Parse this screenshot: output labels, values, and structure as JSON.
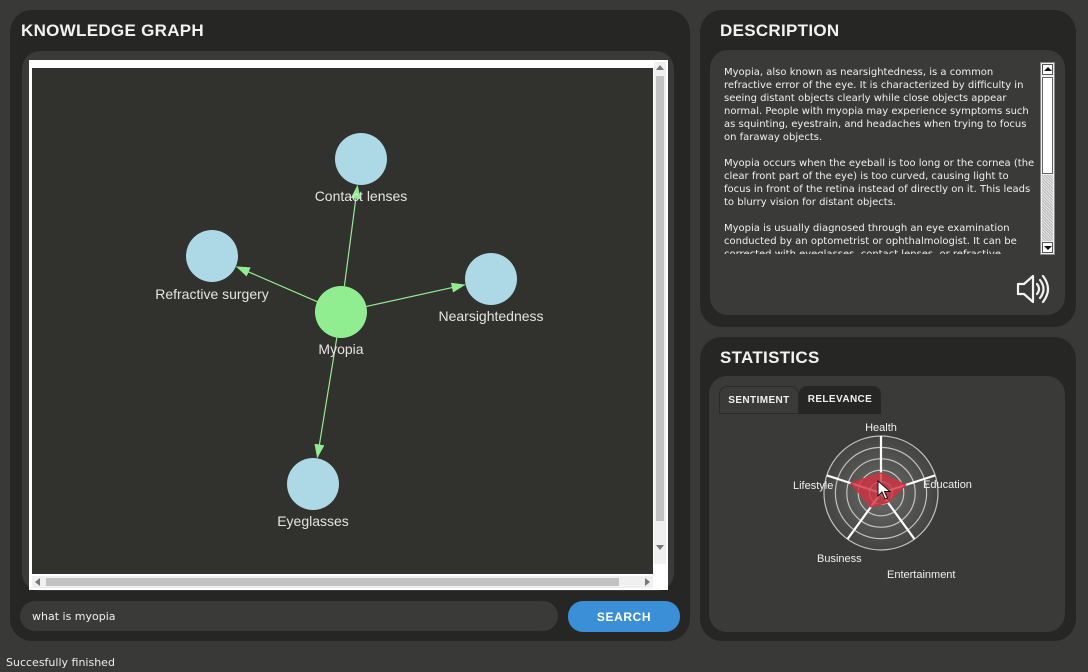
{
  "knowledge_graph": {
    "title": "KNOWLEDGE GRAPH",
    "nodes": [
      {
        "id": "myopia",
        "label": "Myopia",
        "color": "#90ee90"
      },
      {
        "id": "contact",
        "label": "Contact lenses",
        "color": "#add8e6"
      },
      {
        "id": "refractive",
        "label": "Refractive surgery",
        "color": "#add8e6"
      },
      {
        "id": "nearsight",
        "label": "Nearsightedness",
        "color": "#add8e6"
      },
      {
        "id": "eyeglasses",
        "label": "Eyeglasses",
        "color": "#add8e6"
      }
    ],
    "edges": [
      {
        "from": "myopia",
        "to": "contact"
      },
      {
        "from": "myopia",
        "to": "refractive"
      },
      {
        "from": "myopia",
        "to": "nearsight"
      },
      {
        "from": "myopia",
        "to": "eyeglasses"
      }
    ],
    "edge_color": "#90ee90",
    "query_value": "what is myopia",
    "search_label": "SEARCH"
  },
  "description": {
    "title": "DESCRIPTION",
    "paragraphs": [
      "Myopia, also known as nearsightedness, is a common refractive error of the eye. It is characterized by difficulty in seeing distant objects clearly while close objects appear normal. People with myopia may experience symptoms such as squinting, eyestrain, and headaches when trying to focus on faraway objects.",
      "Myopia occurs when the eyeball is too long or the cornea (the clear front part of the eye) is too curved, causing light to focus in front of the retina instead of directly on it. This leads to blurry vision for distant objects.",
      "Myopia is usually diagnosed through an eye examination conducted by an optometrist or ophthalmologist. It can be corrected with eyeglasses, contact lenses, or refractive surgery."
    ],
    "speaker_icon": "speaker-icon"
  },
  "statistics": {
    "title": "STATISTICS",
    "tabs": [
      {
        "label": "SENTIMENT",
        "active": false
      },
      {
        "label": "RELEVANCE",
        "active": true
      }
    ],
    "accent_color": "#d1313f"
  },
  "chart_data": {
    "type": "radar",
    "categories": [
      "Health",
      "Education",
      "Entertainment",
      "Business",
      "Lifestyle"
    ],
    "values": [
      0.35,
      0.45,
      0.2,
      0.3,
      0.55
    ],
    "range": [
      0,
      1
    ],
    "rings": 5
  },
  "status": "Succesfully finished"
}
